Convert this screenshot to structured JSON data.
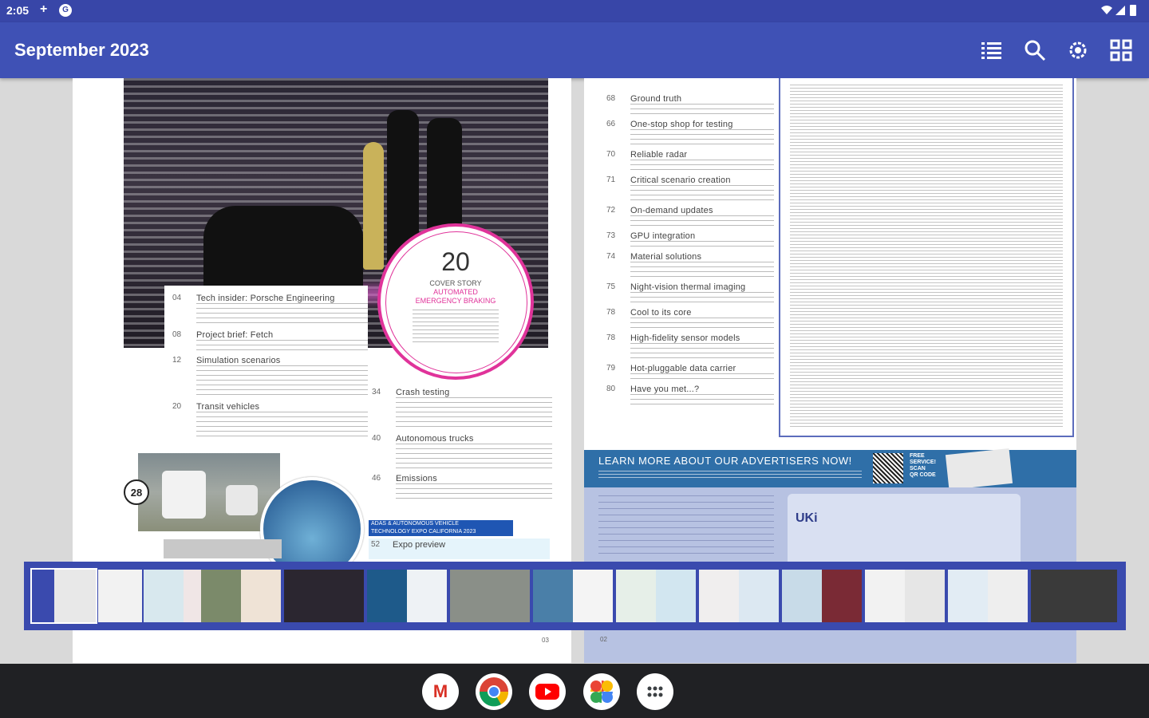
{
  "status_bar": {
    "time": "2:05",
    "plus": "+",
    "notif": "G"
  },
  "app_bar": {
    "title": "September 2023",
    "icons": [
      "list-icon",
      "search-icon",
      "settings-icon",
      "grid-icon"
    ]
  },
  "left_page": {
    "toc": [
      {
        "num": "04",
        "title": "Tech insider: Porsche Engineering"
      },
      {
        "num": "08",
        "title": "Project brief: Fetch"
      },
      {
        "num": "12",
        "title": "Simulation scenarios"
      },
      {
        "num": "20",
        "title": "Transit vehicles"
      }
    ],
    "cover": {
      "number": "20",
      "kicker": "COVER STORY",
      "headline_1": "AUTOMATED",
      "headline_2": "EMERGENCY BRAKING"
    },
    "mid_toc": [
      {
        "num": "34",
        "title": "Crash testing"
      },
      {
        "num": "40",
        "title": "Autonomous trucks"
      },
      {
        "num": "46",
        "title": "Emissions"
      }
    ],
    "badge": "28",
    "adas_label_1": "ADAS & AUTONOMOUS VEHICLE",
    "adas_label_2": "TECHNOLOGY EXPO CALIFORNIA 2023",
    "expo": {
      "num": "52",
      "title": "Expo preview"
    },
    "page_number": "03"
  },
  "right_page": {
    "toc": [
      {
        "num": "68",
        "title": "Ground truth"
      },
      {
        "num": "66",
        "title": "One-stop shop for testing"
      },
      {
        "num": "70",
        "title": "Reliable radar"
      },
      {
        "num": "71",
        "title": "Critical scenario creation"
      },
      {
        "num": "72",
        "title": "On-demand updates"
      },
      {
        "num": "73",
        "title": "GPU integration"
      },
      {
        "num": "74",
        "title": "Material solutions"
      },
      {
        "num": "75",
        "title": "Night-vision thermal imaging"
      },
      {
        "num": "78",
        "title": "Cool to its core"
      },
      {
        "num": "78",
        "title": "High-fidelity sensor models"
      },
      {
        "num": "79",
        "title": "Hot-pluggable data carrier"
      },
      {
        "num": "80",
        "title": "Have you met...?"
      }
    ],
    "learn_banner": "LEARN MORE ABOUT OUR ADVERTISERS NOW!",
    "free_service": [
      "FREE",
      "SERVICE!",
      "SCAN",
      "QR CODE"
    ],
    "uki": "UKi",
    "page_number": "02"
  },
  "thumbnails": {
    "count": 13,
    "selected_index": 0
  },
  "dock": [
    "Gmail",
    "Chrome",
    "YouTube",
    "Photos",
    "App launcher"
  ],
  "colors": {
    "app_bar": "#3f51b5",
    "status_bar": "#3846a8",
    "accent_magenta": "#e0339a",
    "strip": "#3a4aae"
  }
}
